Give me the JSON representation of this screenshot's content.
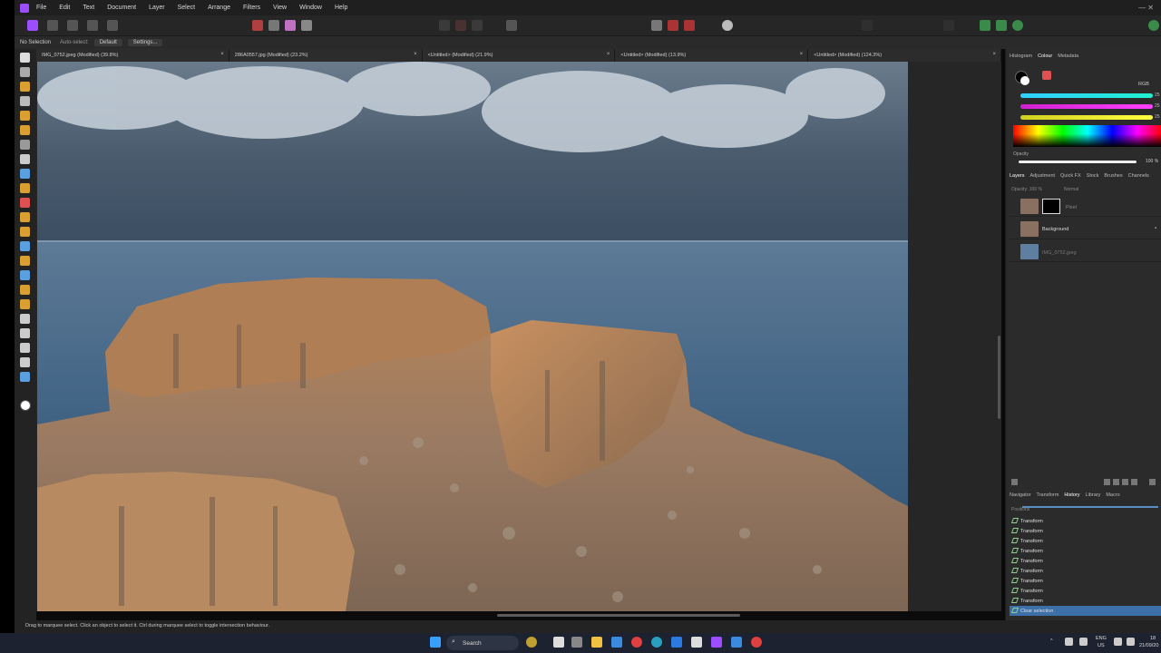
{
  "app": {
    "menu": [
      "File",
      "Edit",
      "Text",
      "Document",
      "Layer",
      "Select",
      "Arrange",
      "Filters",
      "View",
      "Window",
      "Help"
    ],
    "window_controls": "— ✕"
  },
  "context_bar": {
    "selection": "No Selection",
    "auto_select_label": "Auto-select:",
    "auto_select_value": "Default",
    "settings_button": "Settings..."
  },
  "doc_tabs": [
    {
      "label": "IMG_0752.jpeg (Modified) (39.8%)"
    },
    {
      "label": "286A0557.jpg (Modified) (23.2%)"
    },
    {
      "label": "<Untitled> (Modified) (21.9%)"
    },
    {
      "label": "<Untitled> (Modified) (13.9%)"
    },
    {
      "label": "<Untitled> (Modified) (124.3%)"
    }
  ],
  "right_panel": {
    "top_tabs": [
      "Histogram",
      "Colour",
      "Metadata"
    ],
    "active_top_tab": "Colour",
    "color_model": "RGB",
    "slider_values": [
      "25",
      "25",
      "25"
    ],
    "opacity_label": "Opacity",
    "opacity_value": "100 %",
    "layer_tabs": [
      "Layers",
      "Adjustment",
      "Quick FX",
      "Stock",
      "Brushes",
      "Channels"
    ],
    "layer_opacity": "Opacity: 100 %",
    "blend_mode": "Normal",
    "layers": [
      {
        "name": "Pixel"
      },
      {
        "name": "Background"
      },
      {
        "name": "IMG_0752.jpeg"
      }
    ],
    "bottom_tabs": [
      "Navigator",
      "Transform",
      "History",
      "Library",
      "Macro"
    ],
    "active_bottom_tab": "History",
    "history": [
      "Positions",
      "Transform",
      "Transform",
      "Transform",
      "Transform",
      "Transform",
      "Transform",
      "Transform",
      "Transform",
      "Transform",
      "Clear selection"
    ]
  },
  "status": {
    "text": "Drag to marquee select. Click an object to select it. Ctrl during marquee select to toggle intersection behaviour."
  },
  "taskbar": {
    "search": "Search",
    "lang": "ENG",
    "region": "US",
    "time": "18",
    "date": "21/09/20"
  }
}
